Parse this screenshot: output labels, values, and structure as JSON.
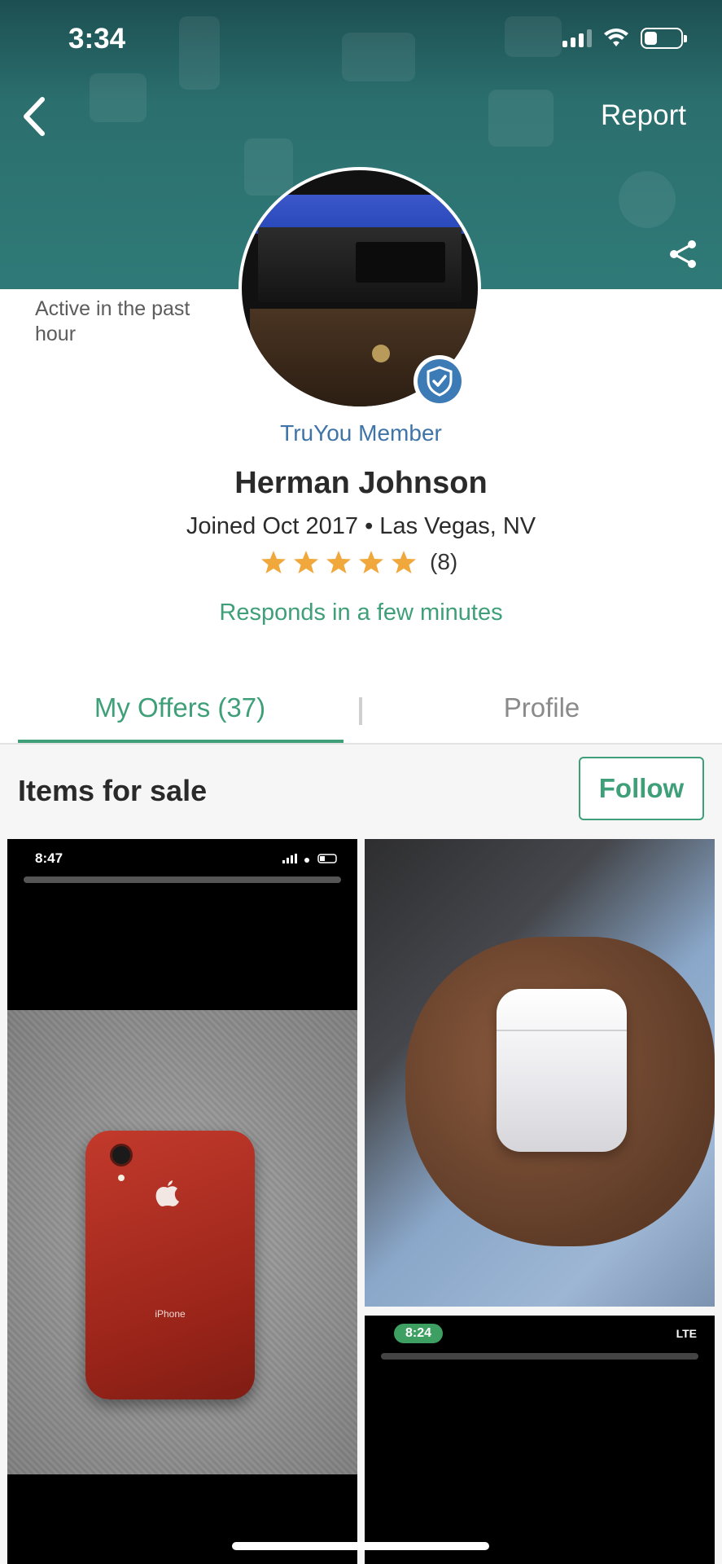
{
  "status_bar": {
    "time": "3:34"
  },
  "header": {
    "report_label": "Report"
  },
  "profile": {
    "active_status": "Active in the past hour",
    "badge_label": "TruYou Member",
    "name": "Herman Johnson",
    "joined": "Joined Oct 2017 • Las Vegas, NV",
    "rating_stars": 5,
    "rating_count": "(8)",
    "response_time": "Responds in a few minutes"
  },
  "tabs": [
    {
      "label": "My Offers (37)",
      "active": true
    },
    {
      "label": "Profile",
      "active": false
    }
  ],
  "items": {
    "title": "Items for sale",
    "follow_label": "Follow",
    "cards": [
      {
        "screenshot_time": "8:47",
        "phone_text": "iPhone"
      },
      {},
      {
        "screenshot_time": "8:24",
        "network": "LTE"
      }
    ]
  },
  "colors": {
    "accent": "#3e9f78",
    "truyou_blue": "#3f74a8",
    "star": "#f0a83c",
    "banner": "#2a6b6b"
  },
  "icons": [
    "back-chevron-icon",
    "share-icon",
    "verified-shield-icon",
    "star-icon",
    "wifi-icon",
    "battery-icon",
    "signal-icon"
  ]
}
